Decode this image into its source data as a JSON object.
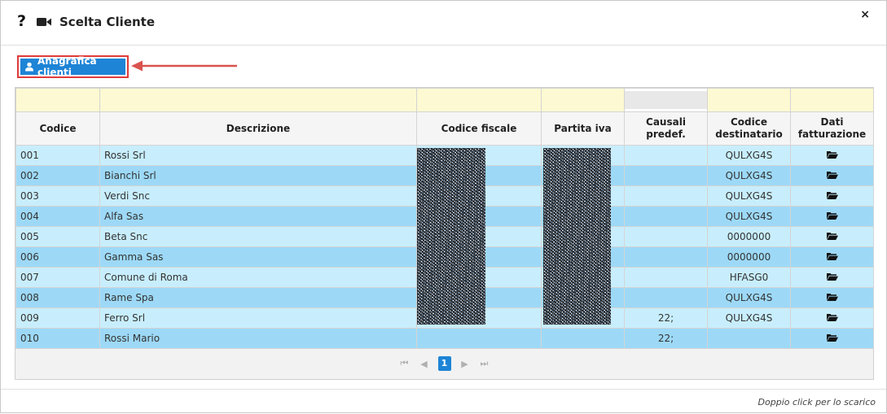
{
  "window": {
    "help_glyph": "?",
    "title": "Scelta Cliente",
    "close_glyph": "×"
  },
  "toolbar": {
    "clients_button_label": "Anagrafica clienti"
  },
  "table": {
    "columns": {
      "codice": "Codice",
      "descrizione": "Descrizione",
      "codice_fiscale": "Codice fiscale",
      "partita_iva": "Partita iva",
      "causali_line1": "Causali",
      "causali_line2": "predef.",
      "destinatario_line1": "Codice",
      "destinatario_line2": "destinatario",
      "fatturazione_line1": "Dati",
      "fatturazione_line2": "fatturazione"
    },
    "rows": [
      {
        "codice": "001",
        "descrizione": "Rossi Srl",
        "causali": "",
        "destinatario": "QULXG4S"
      },
      {
        "codice": "002",
        "descrizione": "Bianchi Srl",
        "causali": "",
        "destinatario": "QULXG4S"
      },
      {
        "codice": "003",
        "descrizione": "Verdi Snc",
        "causali": "",
        "destinatario": "QULXG4S"
      },
      {
        "codice": "004",
        "descrizione": "Alfa Sas",
        "causali": "",
        "destinatario": "QULXG4S"
      },
      {
        "codice": "005",
        "descrizione": "Beta Snc",
        "causali": "",
        "destinatario": "0000000"
      },
      {
        "codice": "006",
        "descrizione": "Gamma Sas",
        "causali": "",
        "destinatario": "0000000"
      },
      {
        "codice": "007",
        "descrizione": "Comune di Roma",
        "causali": "",
        "destinatario": "HFASG0"
      },
      {
        "codice": "008",
        "descrizione": "Rame Spa",
        "causali": "",
        "destinatario": "QULXG4S"
      },
      {
        "codice": "009",
        "descrizione": "Ferro Srl",
        "causali": "22;",
        "destinatario": "QULXG4S"
      },
      {
        "codice": "010",
        "descrizione": "Rossi Mario",
        "causali": "22;",
        "destinatario": ""
      }
    ]
  },
  "pager": {
    "first": "⏮",
    "prev": "◀",
    "current_page": "1",
    "next": "▶",
    "last": "⏭"
  },
  "footer": {
    "hint": "Doppio click per lo scarico"
  },
  "colors": {
    "accent": "#1e84d6",
    "row_light": "#c8eefd",
    "row_dark": "#9dd9f7",
    "filter_row": "#fdf9d2",
    "highlight_border": "#e03b3b"
  },
  "icons": {
    "camera": "video-camera-icon",
    "user": "user-icon",
    "folder": "folder-open-icon",
    "arrow": "red-arrow-icon"
  }
}
